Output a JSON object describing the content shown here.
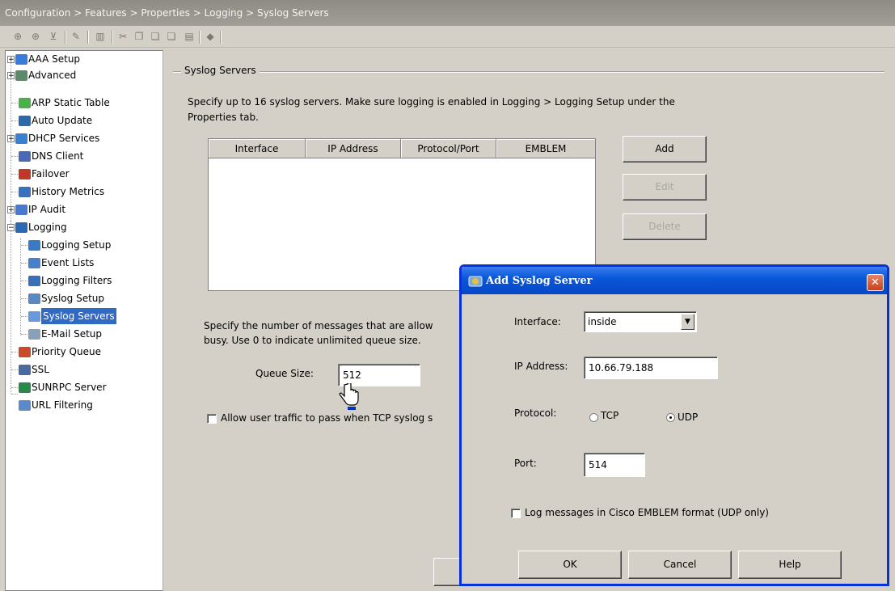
{
  "breadcrumb": "Configuration > Features > Properties > Logging > Syslog Servers",
  "toolbar": {
    "icons": [
      "add-icon",
      "insert-icon",
      "insert-after-icon",
      "edit-icon",
      "delete-icon",
      "cut-icon",
      "copy-icon",
      "paste-icon",
      "paste-after-icon",
      "find-icon",
      "security-icon"
    ]
  },
  "tree": {
    "items": [
      {
        "label": "AAA Setup"
      },
      {
        "label": "Advanced"
      },
      {
        "label": "ARP Static Table"
      },
      {
        "label": "Auto Update"
      },
      {
        "label": "DHCP Services"
      },
      {
        "label": "DNS Client"
      },
      {
        "label": "Failover"
      },
      {
        "label": "History Metrics"
      },
      {
        "label": "IP Audit"
      },
      {
        "label": "Logging"
      },
      {
        "label": "Logging Setup"
      },
      {
        "label": "Event Lists"
      },
      {
        "label": "Logging Filters"
      },
      {
        "label": "Syslog Setup"
      },
      {
        "label": "Syslog Servers"
      },
      {
        "label": "E-Mail Setup"
      },
      {
        "label": "Priority Queue"
      },
      {
        "label": "SSL"
      },
      {
        "label": "SUNRPC Server"
      },
      {
        "label": "URL Filtering"
      }
    ]
  },
  "panel": {
    "group_title": "Syslog Servers",
    "description_line1": "Specify up to 16 syslog servers. Make sure logging is enabled in Logging > Logging Setup under the",
    "description_line2": "Properties tab.",
    "table": {
      "columns": [
        "Interface",
        "IP Address",
        "Protocol/Port",
        "EMBLEM"
      ],
      "rows": []
    },
    "add_label": "Add",
    "edit_label": "Edit",
    "delete_label": "Delete",
    "queue_text_line1": "Specify the number of messages that are allow",
    "queue_text_line2": "busy. Use 0 to indicate unlimited queue size.",
    "queue_size_label": "Queue Size:",
    "queue_size_value": "512",
    "allow_traffic_label": "Allow user traffic to pass when TCP syslog s",
    "allow_traffic_checked": false
  },
  "dialog": {
    "title": "Add Syslog Server",
    "close_glyph": "✕",
    "interface_label": "Interface:",
    "interface_value": "inside",
    "ip_label": "IP Address:",
    "ip_value": "10.66.79.188",
    "protocol_label": "Protocol:",
    "tcp_label": "TCP",
    "udp_label": "UDP",
    "protocol_selected": "UDP",
    "port_label": "Port:",
    "port_value": "514",
    "emblem_label": "Log messages in Cisco EMBLEM format (UDP only)",
    "emblem_checked": false,
    "ok_label": "OK",
    "cancel_label": "Cancel",
    "help_label": "Help"
  },
  "colors": {
    "title_bar": "#0a58d8",
    "selection": "#316ac5",
    "face": "#d4d0c8"
  }
}
